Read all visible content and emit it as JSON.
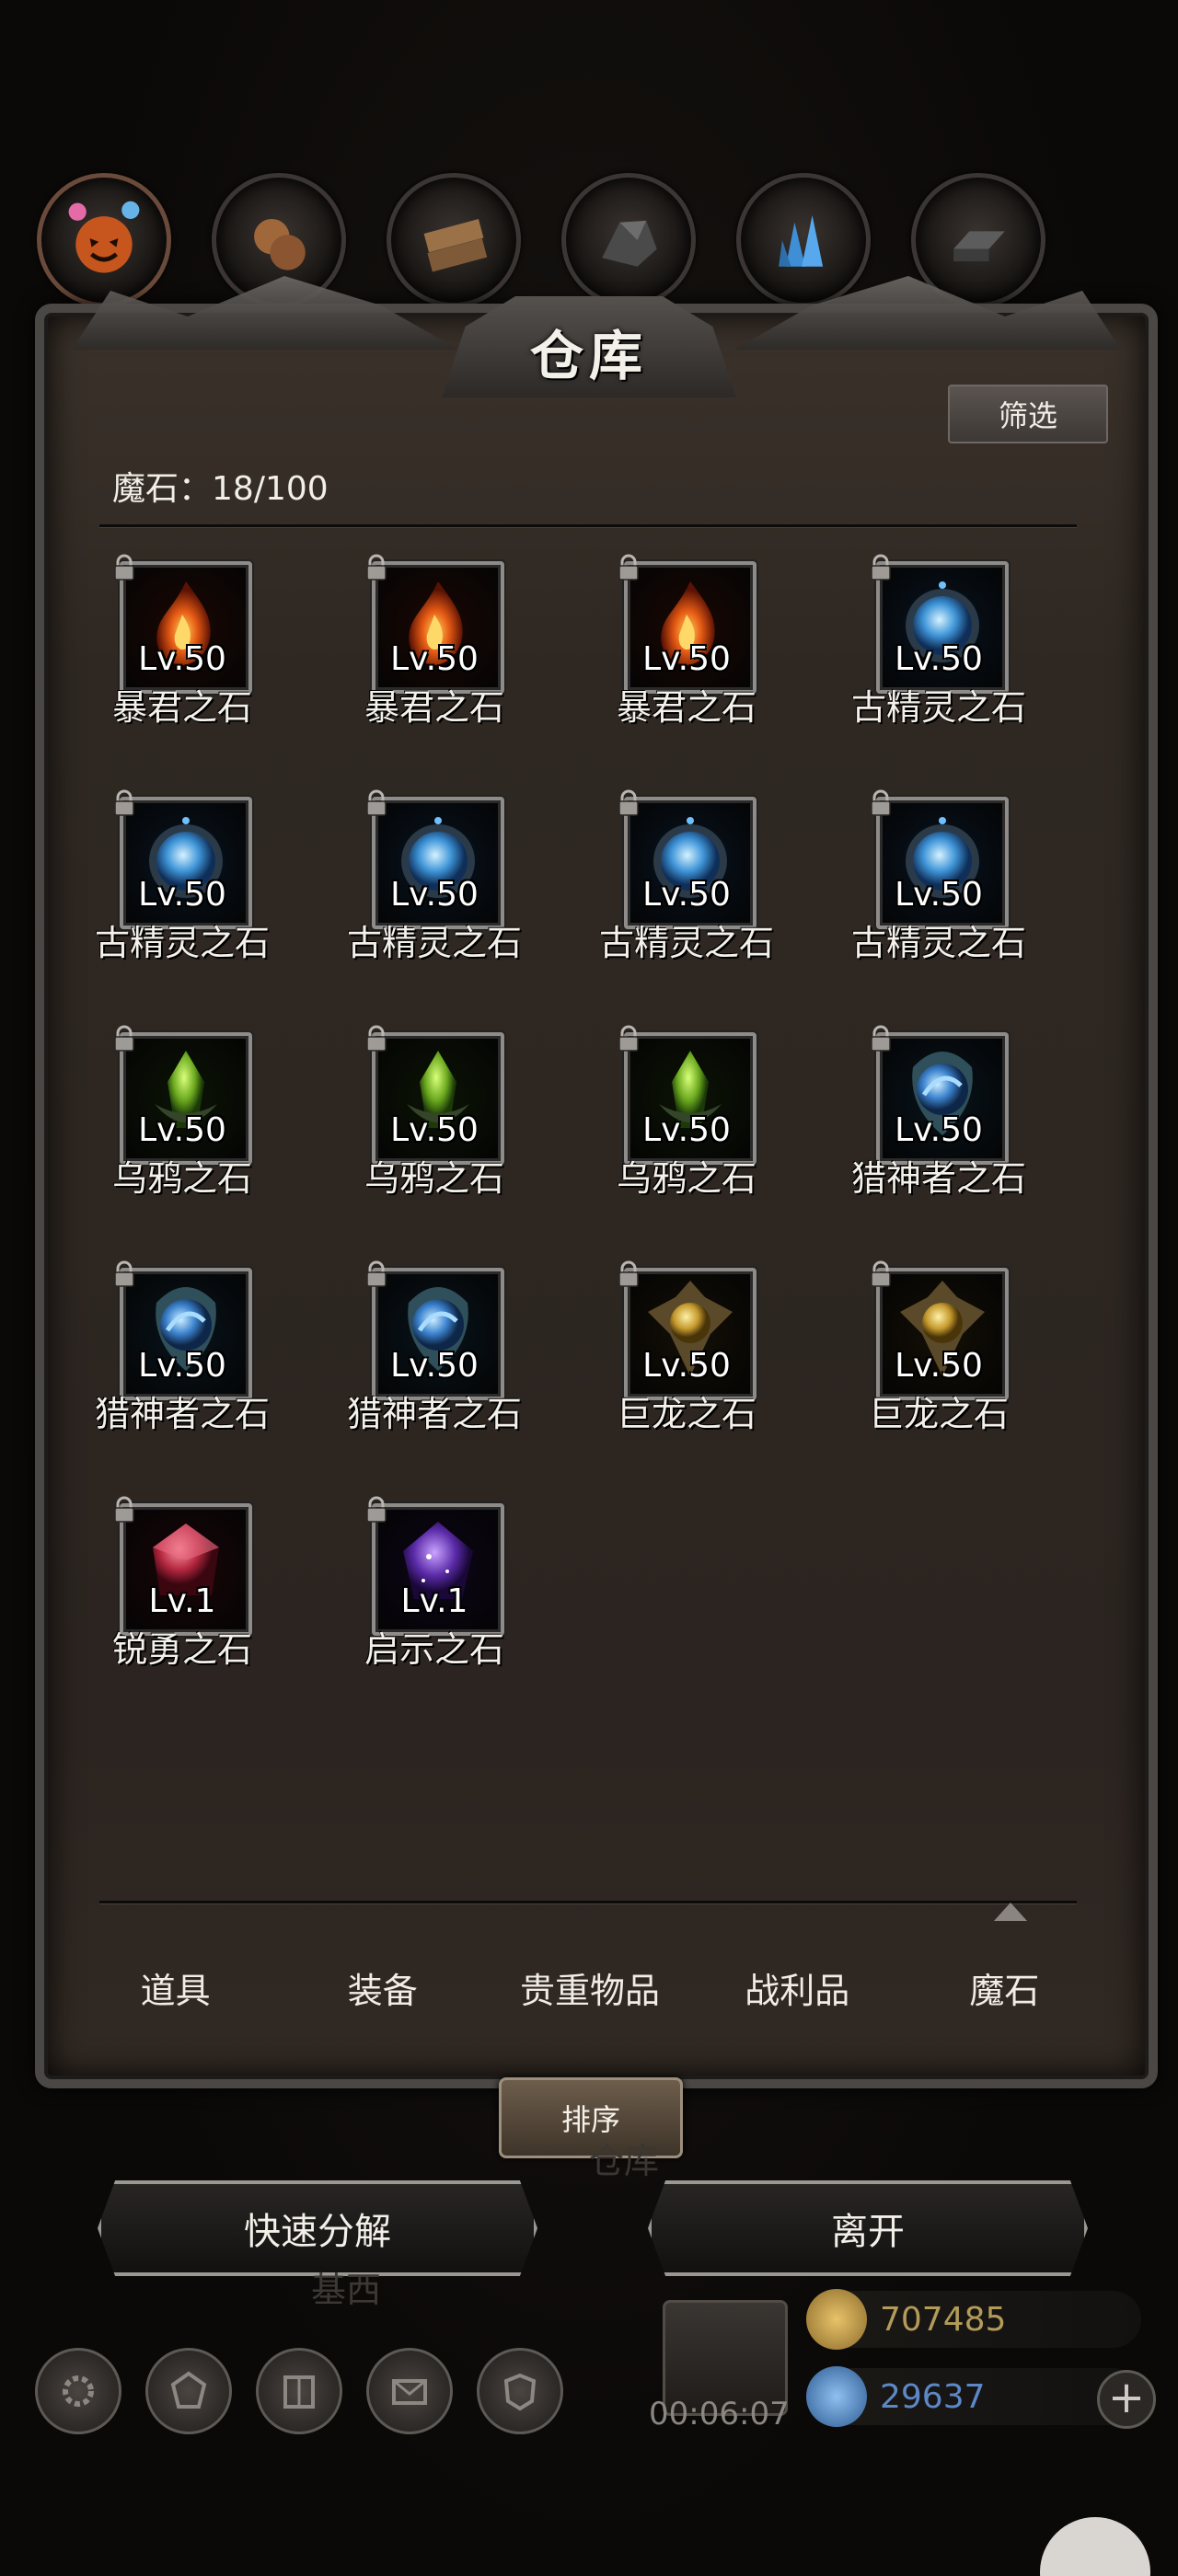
{
  "window": {
    "title": "仓库",
    "filter_label": "筛选"
  },
  "summary": {
    "category_label": "魔石",
    "separator": "：",
    "count": "18/100"
  },
  "items": [
    {
      "name": "暴君之石",
      "level": "Lv.50",
      "kind": "fire",
      "locked": true
    },
    {
      "name": "暴君之石",
      "level": "Lv.50",
      "kind": "fire",
      "locked": true
    },
    {
      "name": "暴君之石",
      "level": "Lv.50",
      "kind": "fire",
      "locked": true
    },
    {
      "name": "古精灵之石",
      "level": "Lv.50",
      "kind": "elf",
      "locked": true
    },
    {
      "name": "古精灵之石",
      "level": "Lv.50",
      "kind": "elf",
      "locked": true
    },
    {
      "name": "古精灵之石",
      "level": "Lv.50",
      "kind": "elf",
      "locked": true
    },
    {
      "name": "古精灵之石",
      "level": "Lv.50",
      "kind": "elf",
      "locked": true
    },
    {
      "name": "古精灵之石",
      "level": "Lv.50",
      "kind": "elf",
      "locked": true
    },
    {
      "name": "乌鸦之石",
      "level": "Lv.50",
      "kind": "crow",
      "locked": true
    },
    {
      "name": "乌鸦之石",
      "level": "Lv.50",
      "kind": "crow",
      "locked": true
    },
    {
      "name": "乌鸦之石",
      "level": "Lv.50",
      "kind": "crow",
      "locked": true
    },
    {
      "name": "猎神者之石",
      "level": "Lv.50",
      "kind": "hunter",
      "locked": true
    },
    {
      "name": "猎神者之石",
      "level": "Lv.50",
      "kind": "hunter",
      "locked": true
    },
    {
      "name": "猎神者之石",
      "level": "Lv.50",
      "kind": "hunter",
      "locked": true
    },
    {
      "name": "巨龙之石",
      "level": "Lv.50",
      "kind": "dragon",
      "locked": true
    },
    {
      "name": "巨龙之石",
      "level": "Lv.50",
      "kind": "dragon",
      "locked": true
    },
    {
      "name": "锐勇之石",
      "level": "Lv.1",
      "kind": "valor",
      "locked": true
    },
    {
      "name": "启示之石",
      "level": "Lv.1",
      "kind": "revelation",
      "locked": true
    }
  ],
  "tabs": [
    {
      "label": "道具",
      "active": false
    },
    {
      "label": "装备",
      "active": false
    },
    {
      "label": "贵重物品",
      "active": false
    },
    {
      "label": "战利品",
      "active": false
    },
    {
      "label": "魔石",
      "active": true
    }
  ],
  "actions": {
    "sort": "排序",
    "quick_dismantle": "快速分解",
    "leave": "离开"
  },
  "background": {
    "faded_title": "仓库",
    "faded_label": "基西"
  },
  "hud": {
    "timer": "00:06:07",
    "gold": "707485",
    "gems": "29637",
    "plus": "+",
    "icons": [
      "settings-icon",
      "badge-icon",
      "book-icon",
      "mail-icon",
      "guild-icon"
    ]
  },
  "colors": {
    "gold_text": "#b39b58",
    "gem_text": "#5d88c8",
    "frame": "#4a4744",
    "panel": "#2f2822"
  }
}
